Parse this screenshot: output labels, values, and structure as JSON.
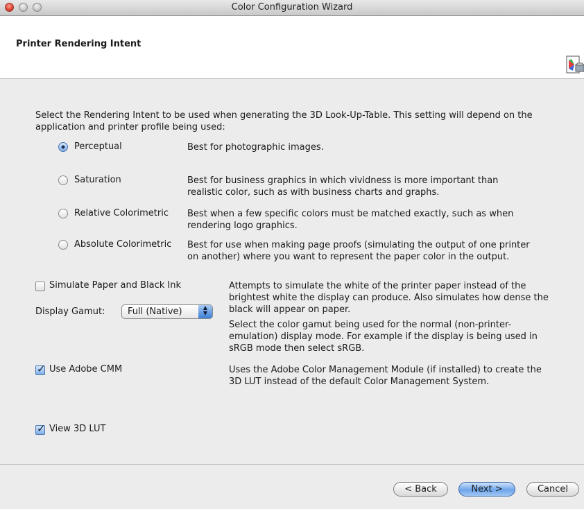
{
  "window": {
    "title": "Color Configuration Wizard"
  },
  "header": {
    "title": "Printer Rendering Intent",
    "icon": "color-wizard-icon"
  },
  "intro": "Select the Rendering Intent to be used when generating the 3D Look-Up-Table. This setting will depend on the application and printer profile being used:",
  "intents": [
    {
      "label": "Perceptual",
      "desc": "Best for photographic images.",
      "selected": true
    },
    {
      "label": "Saturation",
      "desc": "Best for business graphics in which vividness is more important than realistic color, such as with business charts and graphs.",
      "selected": false
    },
    {
      "label": "Relative Colorimetric",
      "desc": "Best when a few specific colors must be matched exactly, such as when rendering logo graphics.",
      "selected": false
    },
    {
      "label": "Absolute Colorimetric",
      "desc": "Best for use when making page proofs (simulating the output of one printer on another) where you want to represent the paper color in the output.",
      "selected": false
    }
  ],
  "options": {
    "simulate_paper": {
      "label": "Simulate Paper and Black Ink",
      "checked": false,
      "desc": "Attempts to simulate the white of the printer paper instead of the brightest white the display can produce. Also simulates how dense the black will appear on paper."
    },
    "display_gamut": {
      "label": "Display Gamut:",
      "value": "Full (Native)",
      "desc": "Select the color gamut being used for the normal (non-printer-emulation) display mode. For example if the display is being used in sRGB mode then select sRGB."
    },
    "adobe_cmm": {
      "label": "Use Adobe CMM",
      "checked": true,
      "desc": "Uses the Adobe Color Management Module (if installed) to create the 3D LUT instead of the default Color Management System."
    },
    "view_lut": {
      "label": "View 3D LUT",
      "checked": true
    }
  },
  "buttons": {
    "back": "< Back",
    "next": "Next >",
    "cancel": "Cancel"
  }
}
